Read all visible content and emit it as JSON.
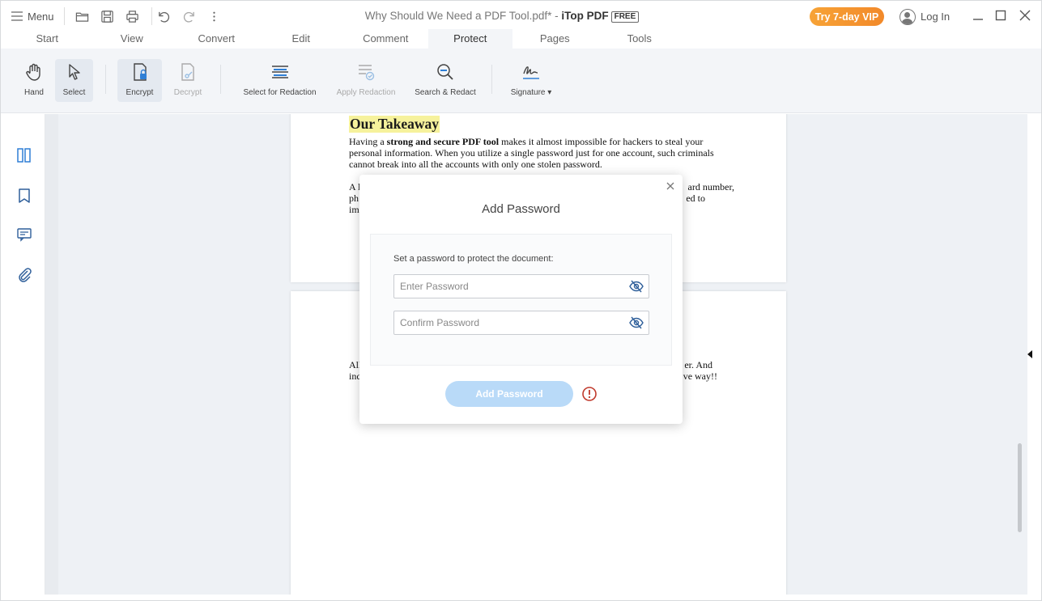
{
  "titlebar": {
    "menu_label": "Menu",
    "doc_name": "Why Should We Need a PDF Tool.pdf*",
    "separator": " - ",
    "app_name": "iTop PDF",
    "free_badge": "FREE",
    "vip_button": "Try 7-day VIP",
    "login_label": "Log In"
  },
  "tabs": [
    {
      "label": "Start"
    },
    {
      "label": "View"
    },
    {
      "label": "Convert"
    },
    {
      "label": "Edit"
    },
    {
      "label": "Comment"
    },
    {
      "label": "Protect"
    },
    {
      "label": "Pages"
    },
    {
      "label": "Tools"
    }
  ],
  "active_tab": "Protect",
  "ribbon": {
    "hand": "Hand",
    "select": "Select",
    "encrypt": "Encrypt",
    "decrypt": "Decrypt",
    "select_redaction": "Select for Redaction",
    "apply_redaction": "Apply Redaction",
    "search_redact": "Search & Redact",
    "signature": "Signature ▾"
  },
  "document": {
    "heading": "Our Takeaway",
    "para1_pre": "Having a ",
    "para1_bold": "strong and secure PDF tool",
    "para1_post": " makes it almost impossible for hackers to steal your personal information. When you utilize a single password just for one account, such criminals cannot break into all the accounts with only one stolen password.",
    "para2_start": "A l",
    "para2_end": "ard number,",
    "para2_line2_start": "ph",
    "para2_line2_end": "ed to",
    "para2_line3_start": "im",
    "para3_start": "All",
    "para3_end": "er. And",
    "para3_line2_start": "inc",
    "para3_line2_end": "ve way!!"
  },
  "dialog": {
    "title": "Add Password",
    "instruction": "Set a password to protect the document:",
    "enter_placeholder": "Enter Password",
    "confirm_placeholder": "Confirm Password",
    "add_button": "Add Password"
  },
  "colors": {
    "accent": "#2f7fd6",
    "vip_orange": "#f2892a",
    "highlight": "#f6f29c",
    "button_disabled": "#b9daf8",
    "warning": "#c0392b"
  }
}
